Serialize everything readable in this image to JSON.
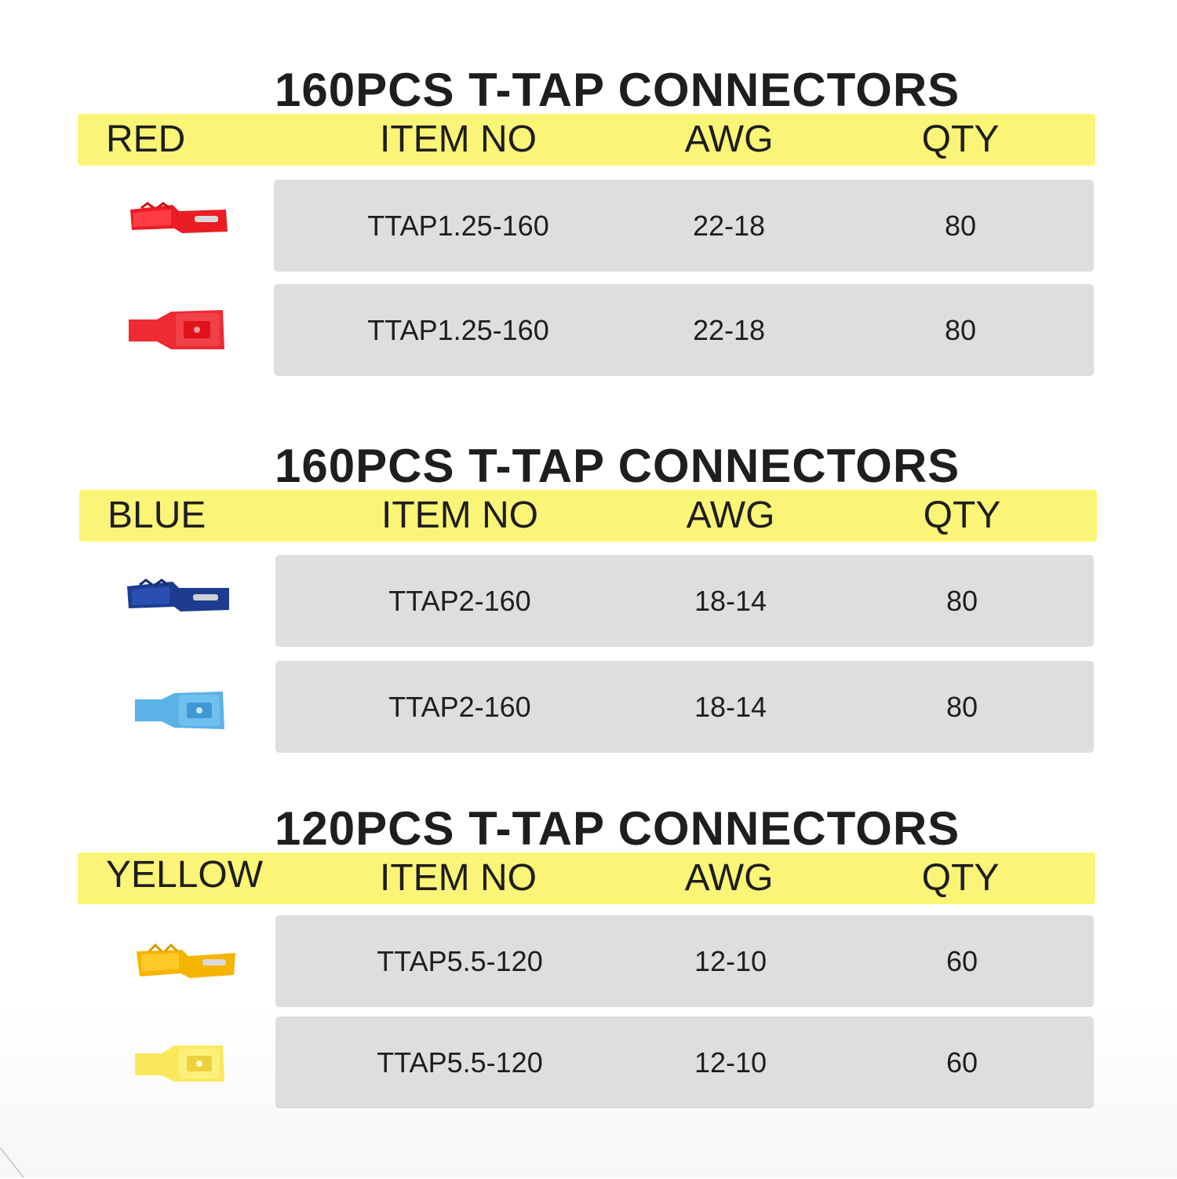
{
  "sections": [
    {
      "title": "160PCS T-TAP CONNECTORS",
      "header": {
        "color": "RED",
        "item": "ITEM NO",
        "awg": "AWG",
        "qty": "QTY"
      },
      "accent": "#e8212b",
      "rows": [
        {
          "icon": "red-t-tap-connector-icon",
          "item": "TTAP1.25-160",
          "awg": "22-18",
          "qty": "80"
        },
        {
          "icon": "red-male-quick-disconnect-icon",
          "item": "TTAP1.25-160",
          "awg": "22-18",
          "qty": "80"
        }
      ]
    },
    {
      "title": "160PCS T-TAP CONNECTORS",
      "header": {
        "color": "BLUE",
        "item": "ITEM NO",
        "awg": "AWG",
        "qty": "QTY"
      },
      "accent": "#1f3f99",
      "rows": [
        {
          "icon": "blue-t-tap-connector-icon",
          "item": "TTAP2-160",
          "awg": "18-14",
          "qty": "80"
        },
        {
          "icon": "blue-male-quick-disconnect-icon",
          "item": "TTAP2-160",
          "awg": "18-14",
          "qty": "80"
        }
      ]
    },
    {
      "title": "120PCS T-TAP CONNECTORS",
      "header": {
        "color": "YELLOW",
        "item": "ITEM NO",
        "awg": "AWG",
        "qty": "QTY"
      },
      "accent": "#f5b800",
      "rows": [
        {
          "icon": "yellow-t-tap-connector-icon",
          "item": "TTAP5.5-120",
          "awg": "12-10",
          "qty": "60"
        },
        {
          "icon": "yellow-male-quick-disconnect-icon",
          "item": "TTAP5.5-120",
          "awg": "12-10",
          "qty": "60"
        }
      ]
    }
  ],
  "colors": {
    "header_band": "#fbf577",
    "row_bg": "#dedede",
    "text": "#1e1e1e"
  }
}
